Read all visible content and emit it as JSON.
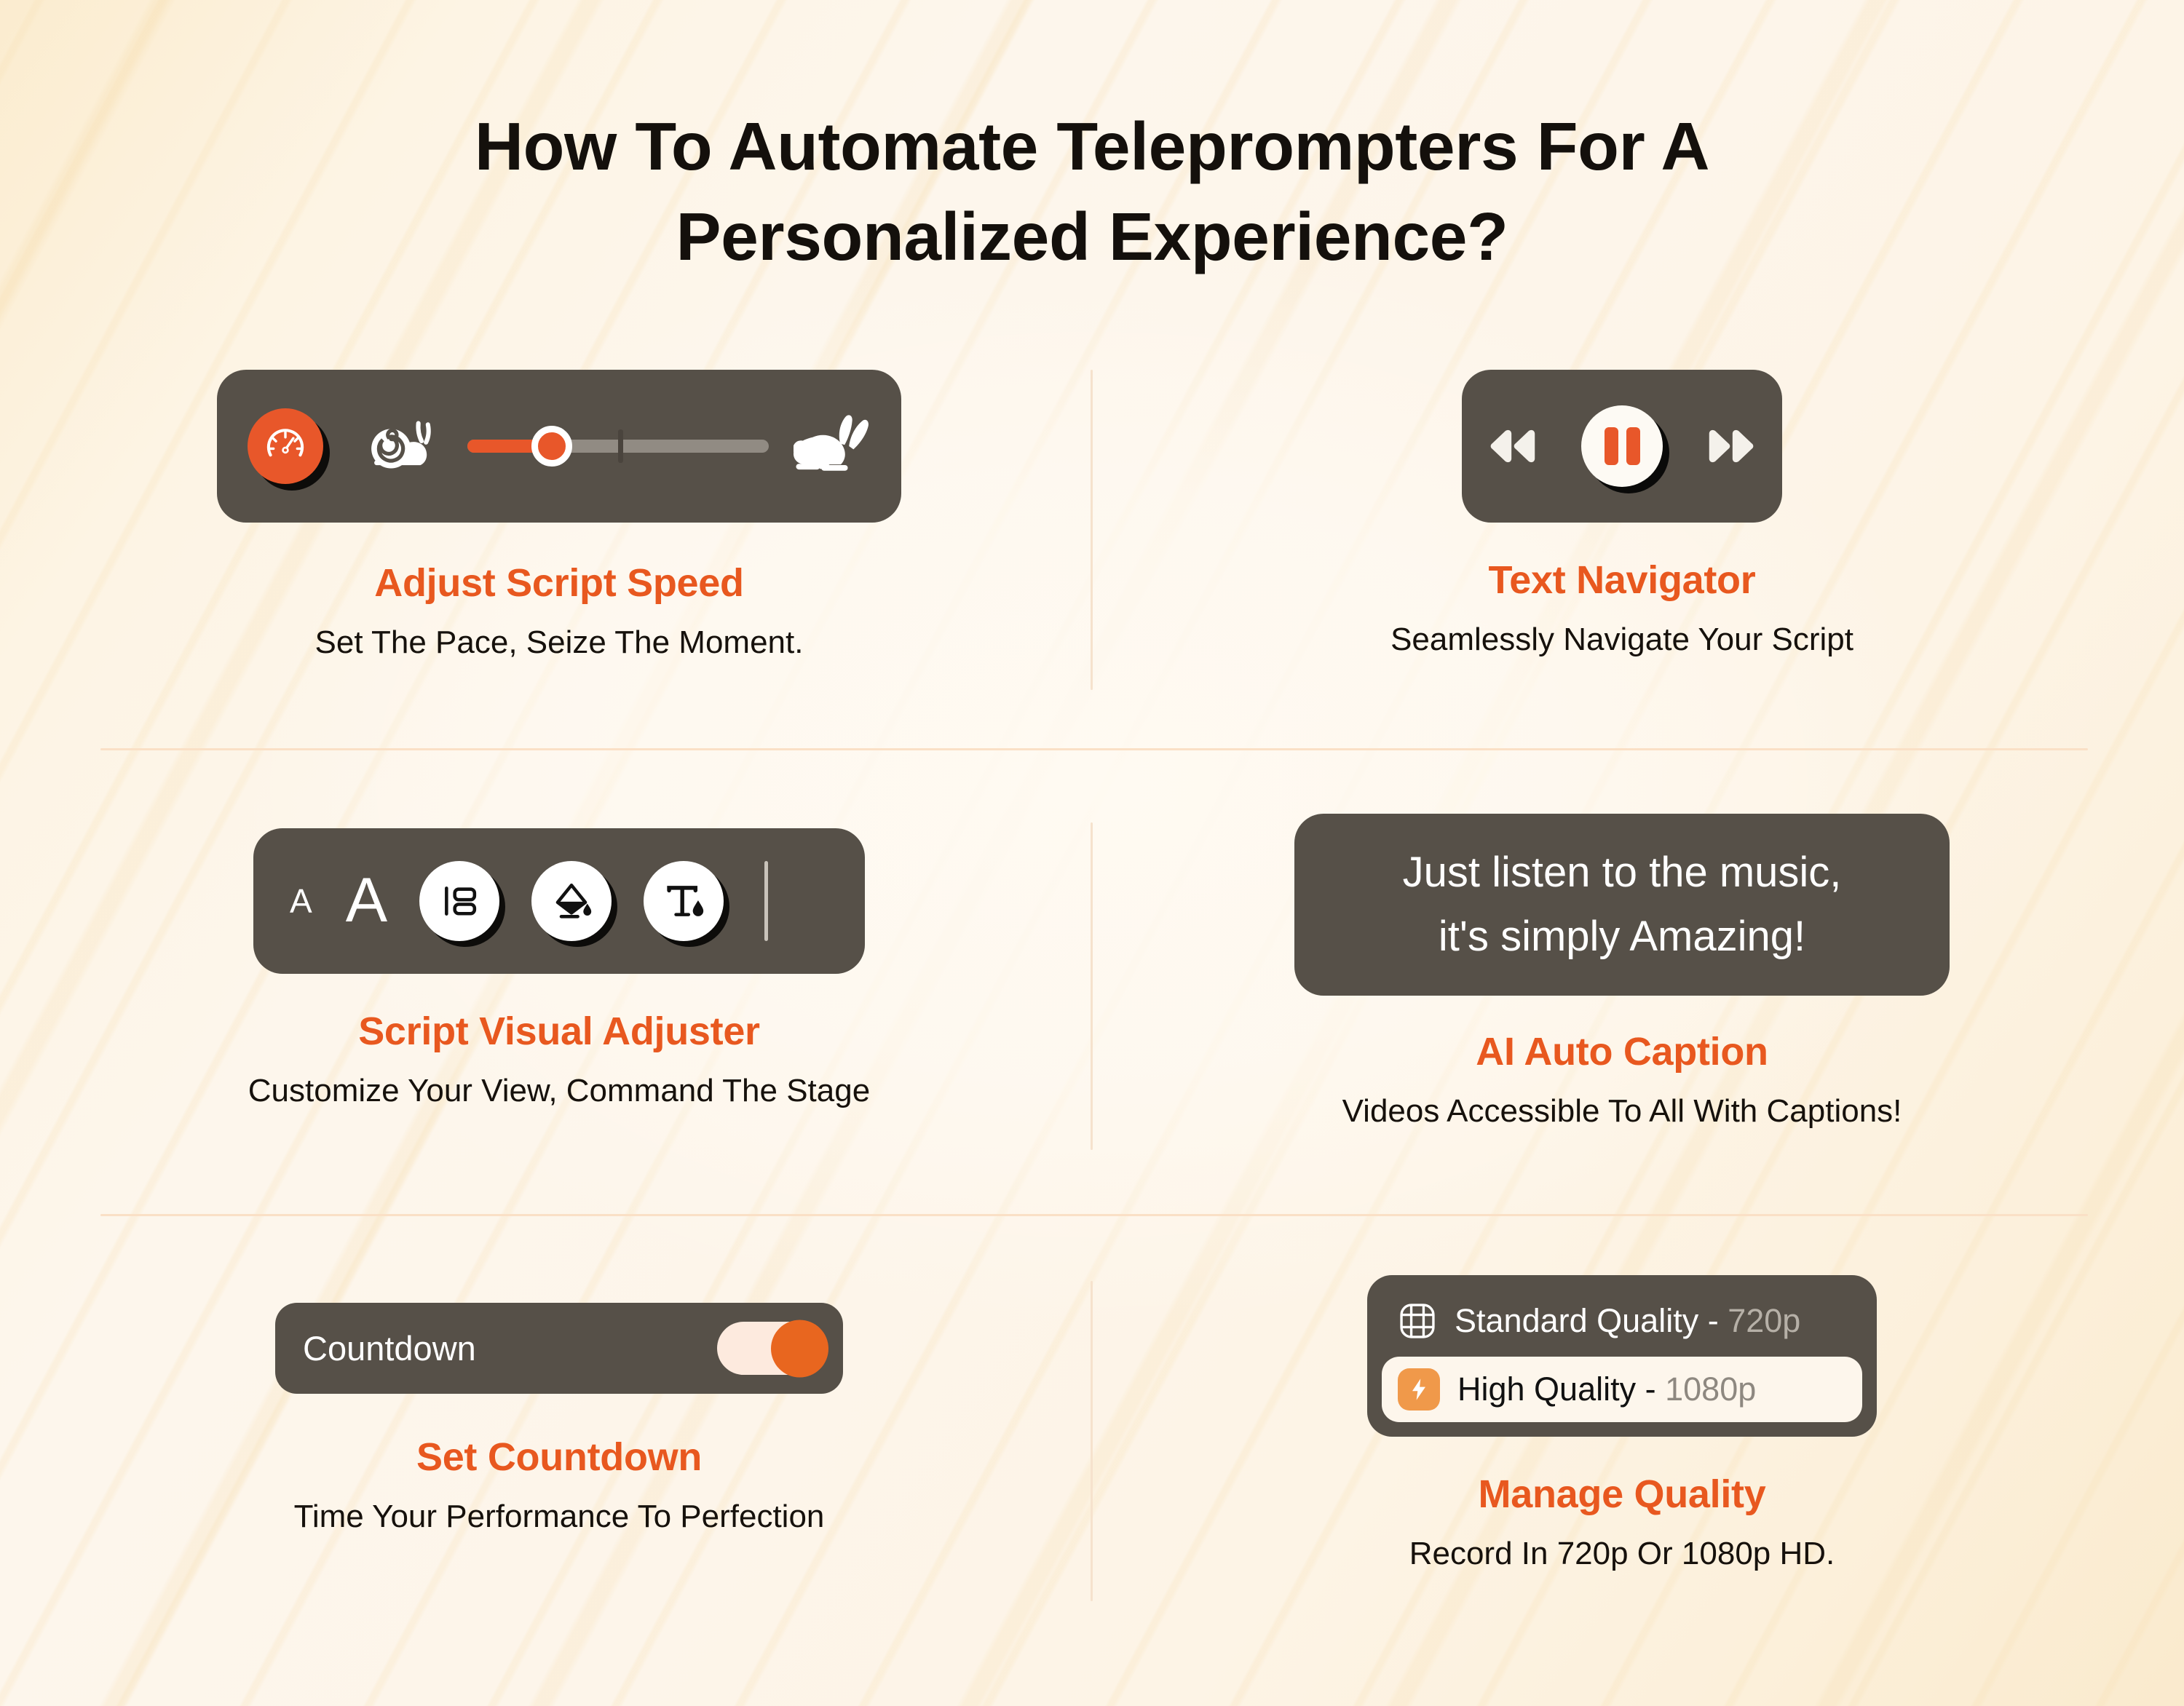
{
  "title": "How To Automate Teleprompters For A Personalized Experience?",
  "theme": {
    "accent": "#e8581f",
    "panel": "#565048",
    "background": "#fdf4e6",
    "divider": "#f6e2cd",
    "text_dark": "#16110c",
    "text_light": "#ffffff"
  },
  "cards": {
    "speed": {
      "title": "Adjust Script Speed",
      "subtitle": "Set The Pace, Seize The Moment.",
      "icons": {
        "gauge": "speedometer-icon",
        "slow": "snail-icon",
        "fast": "rabbit-icon"
      },
      "slider_value_percent": 28
    },
    "navigator": {
      "title": "Text Navigator",
      "subtitle": "Seamlessly Navigate Your Script",
      "icons": {
        "rewind": "rewind-icon",
        "pause": "pause-icon",
        "forward": "fast-forward-icon"
      }
    },
    "visual": {
      "title": "Script Visual Adjuster",
      "subtitle": "Customize Your View, Command The Stage",
      "small_a": "A",
      "large_a": "A",
      "tools": [
        {
          "name": "align-text-icon"
        },
        {
          "name": "fill-color-icon"
        },
        {
          "name": "text-color-icon"
        }
      ]
    },
    "caption": {
      "title": "AI Auto Caption",
      "subtitle": "Videos Accessible To All With Captions!",
      "lines": [
        "Just listen to the music,",
        "it's simply Amazing!"
      ]
    },
    "countdown": {
      "title": "Set Countdown",
      "subtitle": "Time Your Performance To Perfection",
      "toggle_label": "Countdown",
      "toggle_state": "on"
    },
    "quality": {
      "title": "Manage Quality",
      "subtitle": "Record In 720p Or 1080p HD.",
      "options": [
        {
          "label": "Standard Quality - ",
          "resolution": "720p",
          "icon": "film-strip-icon",
          "selected": false
        },
        {
          "label": "High Quality - ",
          "resolution": "1080p",
          "icon": "lightning-bolt-icon",
          "selected": true
        }
      ]
    }
  }
}
